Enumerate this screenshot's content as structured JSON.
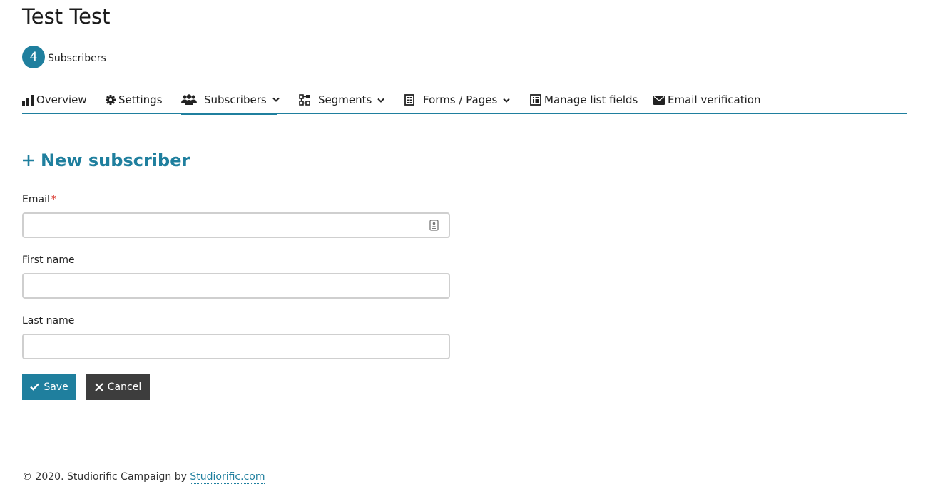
{
  "header": {
    "list_title": "Test Test",
    "subscriber_count": "4",
    "subscriber_count_label": "Subscribers"
  },
  "nav": {
    "items": [
      {
        "label": "Overview",
        "icon": "bar-chart-icon",
        "dropdown": false,
        "active": false
      },
      {
        "label": "Settings",
        "icon": "gear-icon",
        "dropdown": false,
        "active": false
      },
      {
        "label": "Subscribers",
        "icon": "users-icon",
        "dropdown": true,
        "active": true
      },
      {
        "label": "Segments",
        "icon": "segments-icon",
        "dropdown": true,
        "active": false
      },
      {
        "label": "Forms / Pages",
        "icon": "form-icon",
        "dropdown": true,
        "active": false
      },
      {
        "label": "Manage list fields",
        "icon": "list-fields-icon",
        "dropdown": false,
        "active": false
      },
      {
        "label": "Email verification",
        "icon": "envelope-icon",
        "dropdown": false,
        "active": false
      }
    ]
  },
  "form": {
    "title": "New subscriber",
    "fields": {
      "email": {
        "label": "Email",
        "required_marker": "*",
        "value": ""
      },
      "first_name": {
        "label": "First name",
        "value": ""
      },
      "last_name": {
        "label": "Last name",
        "value": ""
      }
    },
    "save_label": "Save",
    "cancel_label": "Cancel"
  },
  "footer": {
    "text": "© 2020. Studiorific Campaign by",
    "link_text": "Studiorific.com"
  },
  "colors": {
    "accent": "#1f7f9e",
    "cancel": "#3d3d3d",
    "required": "#d9352b"
  }
}
